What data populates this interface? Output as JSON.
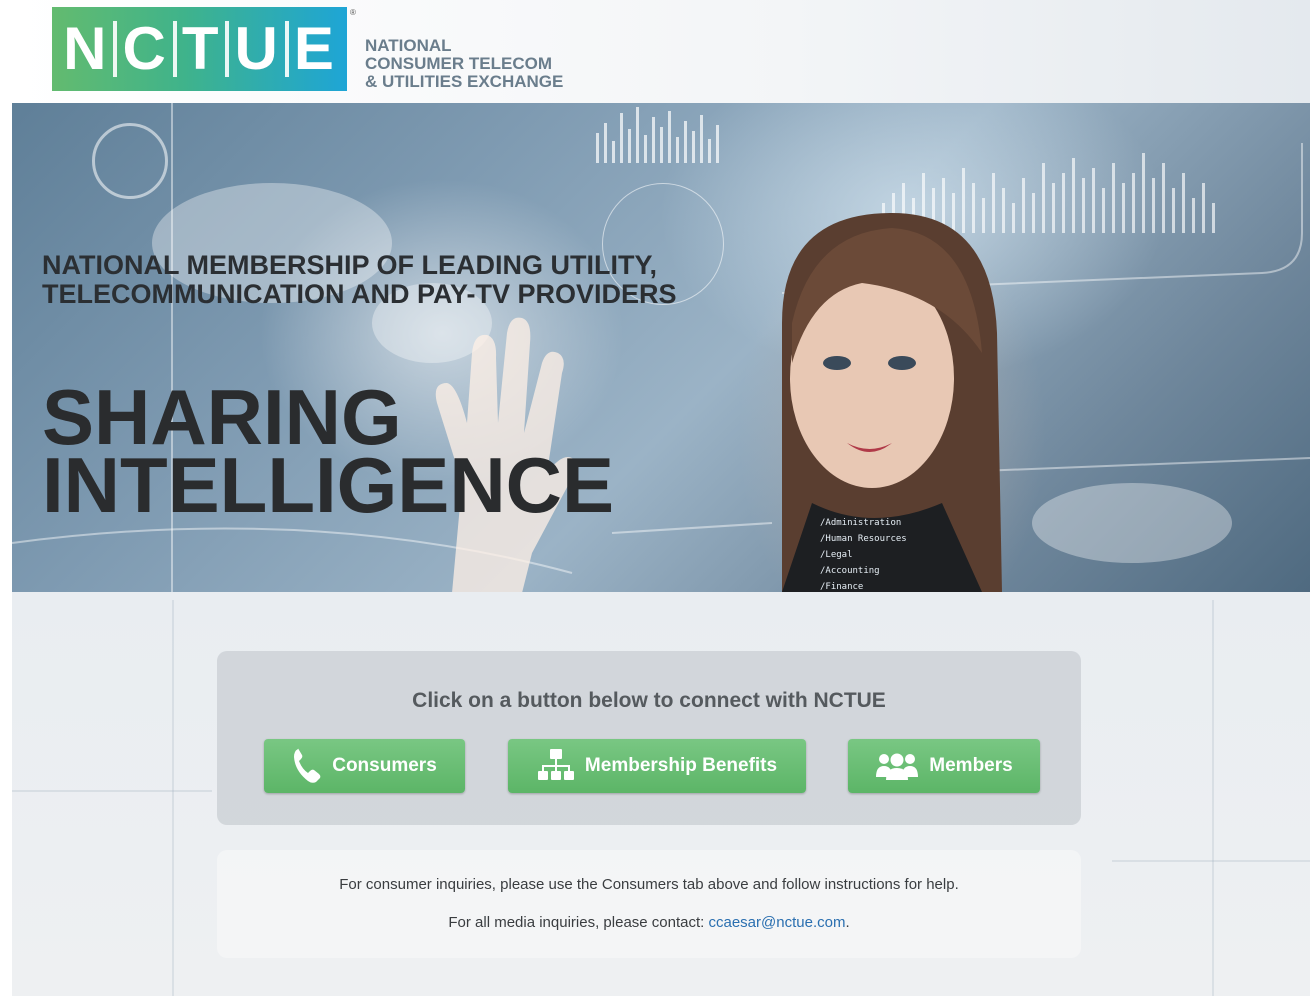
{
  "brand": {
    "logo_letters": [
      "N",
      "C",
      "T",
      "U",
      "E"
    ],
    "registered_mark": "®",
    "tagline": [
      "NATIONAL",
      "CONSUMER TELECOM",
      "& UTILITIES EXCHANGE"
    ],
    "colors": {
      "green": "#63bb6f",
      "teal": "#3fb38b",
      "blue": "#1ea5d6"
    }
  },
  "hero": {
    "subtitle_lines": [
      "NATIONAL MEMBERSHIP OF LEADING UTILITY,",
      "TELECOMMUNICATION AND PAY-TV PROVIDERS"
    ],
    "title_lines": [
      "SHARING",
      "INTELLIGENCE"
    ],
    "overlay_text": [
      "/Administration",
      "/Human Resources",
      "/Legal",
      "/Accounting",
      "/Finance"
    ]
  },
  "connect": {
    "prompt": "Click on a button below to connect with NCTUE",
    "buttons": [
      {
        "label": "Consumers",
        "icon": "phone-icon"
      },
      {
        "label": "Membership Benefits",
        "icon": "org-chart-icon"
      },
      {
        "label": "Members",
        "icon": "people-group-icon"
      }
    ],
    "button_color": "#5cb567"
  },
  "info": {
    "consumer_line": "For consumer inquiries, please use the Consumers tab above and follow instructions for help.",
    "media_prefix": "For all media inquiries, please contact:",
    "media_email": "ccaesar@nctue.com",
    "media_suffix": "."
  }
}
